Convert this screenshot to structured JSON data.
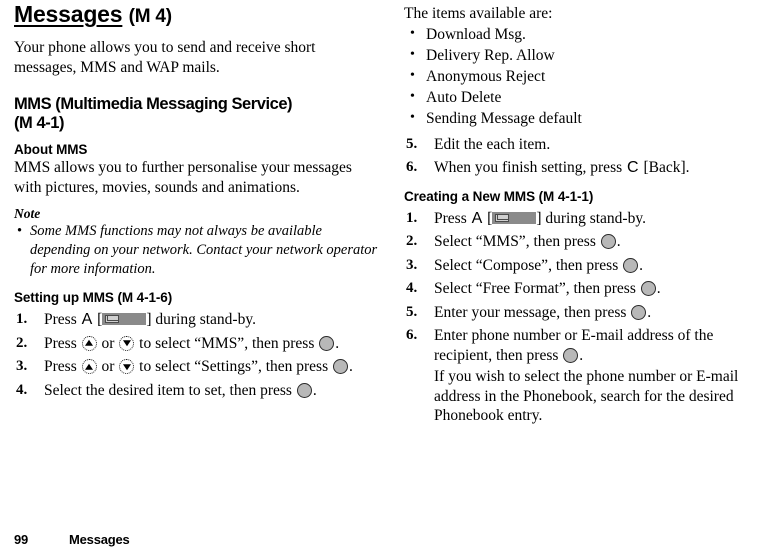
{
  "document": {
    "chapter_title": "Messages",
    "chapter_code": "(M 4)",
    "intro": "Your phone allows you to send and receive short messages, MMS and WAP mails."
  },
  "left_column": {
    "mms_heading": "MMS (Multimedia Messaging Service)",
    "mms_heading_line2": "(M 4-1)",
    "about_heading": "About MMS",
    "about_text": "MMS allows you to further personalise your messages with pictures, movies, sounds and animations.",
    "note_label": "Note",
    "note_bullet": "•",
    "note_text": "Some MMS functions may not always be available depending on your network. Contact your network operator for more information.",
    "setting_heading": "Setting up MMS (M 4-1-6)",
    "steps": [
      {
        "num": "1.",
        "pre": "Press ",
        "key": "A",
        "bracket_open": " [",
        "softkey": "message-softkey",
        "bracket_close": "] ",
        "post": "during stand-by."
      },
      {
        "num": "2.",
        "pre": "Press ",
        "navup": "up-arrow-key",
        "mid1": " or ",
        "navdown": "down-arrow-key",
        "mid2": " to select “MMS”, then press ",
        "centerkey": "center-select-key",
        "post": "."
      },
      {
        "num": "3.",
        "pre": "Press ",
        "navup": "up-arrow-key",
        "mid1": " or ",
        "navdown": "down-arrow-key",
        "mid2": " to select “Settings”, then press ",
        "centerkey": "center-select-key",
        "post": "."
      },
      {
        "num": "4.",
        "pre": "Select the desired item to set, then press ",
        "centerkey": "center-select-key",
        "post": "."
      }
    ]
  },
  "right_column": {
    "items_intro": "The items available are:",
    "items": [
      "Download Msg.",
      "Delivery Rep. Allow",
      "Anonymous Reject",
      "Auto Delete",
      "Sending Message default"
    ],
    "bullet_char": "•",
    "step5": {
      "num": "5.",
      "text": "Edit the each item."
    },
    "step6": {
      "num": "6.",
      "pre": "When you finish setting, press ",
      "key": "C",
      "post": " [Back]."
    },
    "creating_heading": "Creating a New MMS (M 4-1-1)",
    "creating_steps": [
      {
        "num": "1.",
        "pre": "Press ",
        "key": "A",
        "bracket_open": " [",
        "softkey": "message-softkey",
        "bracket_close": "] ",
        "post": "during stand-by."
      },
      {
        "num": "2.",
        "pre": "Select “MMS”, then press ",
        "centerkey": "center-select-key",
        "post": "."
      },
      {
        "num": "3.",
        "pre": "Select “Compose”, then press ",
        "centerkey": "center-select-key",
        "post": "."
      },
      {
        "num": "4.",
        "pre": "Select “Free Format”, then press ",
        "centerkey": "center-select-key",
        "post": "."
      },
      {
        "num": "5.",
        "pre": "Enter your message, then press ",
        "centerkey": "center-select-key",
        "post": "."
      },
      {
        "num": "6.",
        "pre": "Enter phone number or E-mail address of the recipient, then press ",
        "centerkey": "center-select-key",
        "post": ".",
        "sub": "If you wish to select the phone number or E-mail address in the Phonebook, search for the desired Phonebook entry."
      }
    ]
  },
  "footer": {
    "page_number": "99",
    "chapter": "Messages"
  },
  "colors": {
    "text": "#000000",
    "background": "#ffffff",
    "softkey_fill": "#8a8a8a",
    "softkey_icon": "#d0d0d0",
    "center_key_fill": "#b8b8b8"
  }
}
